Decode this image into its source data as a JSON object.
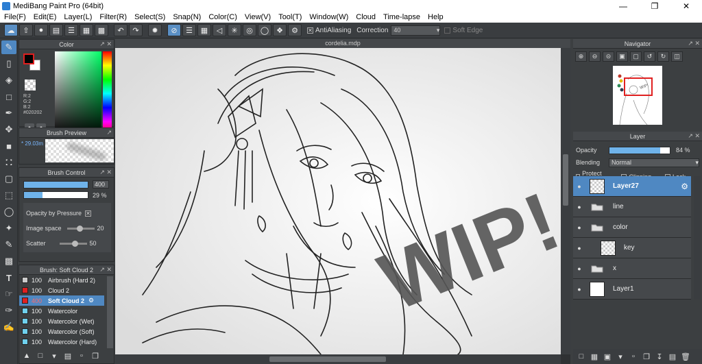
{
  "window": {
    "title": "MediBang Paint Pro (64bit)"
  },
  "menu": [
    "File(F)",
    "Edit(E)",
    "Layer(L)",
    "Filter(R)",
    "Select(S)",
    "Snap(N)",
    "Color(C)",
    "View(V)",
    "Tool(T)",
    "Window(W)",
    "Cloud",
    "Time-lapse",
    "Help"
  ],
  "toolbar": {
    "antialiasing_label": "AntiAliasing",
    "correction_label": "Correction",
    "correction_value": "40",
    "soft_edge_label": "Soft Edge"
  },
  "color_panel": {
    "title": "Color",
    "r": "R:2",
    "g": "G:2",
    "b": "B:2",
    "hex": "#020202",
    "fg_color": "#020202"
  },
  "brush_preview": {
    "title": "Brush Preview",
    "size": "29.03m"
  },
  "brush_control": {
    "title": "Brush Control",
    "size_value": "400",
    "opacity_value": "29 %",
    "opacity_fraction": 0.29,
    "opacity_by_pressure": "Opacity by Pressure",
    "image_space": "Image space",
    "image_space_value": "20",
    "scatter": "Scatter",
    "scatter_value": "50"
  },
  "brush_list": {
    "title": "Brush: Soft Cloud 2",
    "items": [
      {
        "size": "100",
        "name": "Airbrush (Hard 2)",
        "color": "#cccccc"
      },
      {
        "size": "100",
        "name": "Cloud 2",
        "color": "#e02020"
      },
      {
        "size": "400",
        "name": "Soft Cloud 2",
        "color": "#e02020"
      },
      {
        "size": "100",
        "name": "Watercolor",
        "color": "#6fd1ee"
      },
      {
        "size": "100",
        "name": "Watercolor (Wet)",
        "color": "#6fd1ee"
      },
      {
        "size": "100",
        "name": "Watercolor (Soft)",
        "color": "#6fd1ee"
      },
      {
        "size": "100",
        "name": "Watercolor (Hard)",
        "color": "#6fd1ee"
      }
    ]
  },
  "canvas": {
    "tab": "cordelia.mdp"
  },
  "navigator": {
    "title": "Navigator"
  },
  "layer_panel": {
    "title": "Layer",
    "opacity_label": "Opacity",
    "opacity_value": "84 %",
    "opacity_fraction": 0.84,
    "blending_label": "Blending",
    "blending_value": "Normal",
    "protect_alpha": "Protect Alpha",
    "clipping": "Clipping",
    "lock": "Lock",
    "layers": [
      {
        "name": "Layer27",
        "type": "layer"
      },
      {
        "name": "line",
        "type": "folder"
      },
      {
        "name": "color",
        "type": "folder"
      },
      {
        "name": "key",
        "type": "layer"
      },
      {
        "name": "x",
        "type": "folder"
      },
      {
        "name": "Layer1",
        "type": "layer"
      }
    ]
  }
}
